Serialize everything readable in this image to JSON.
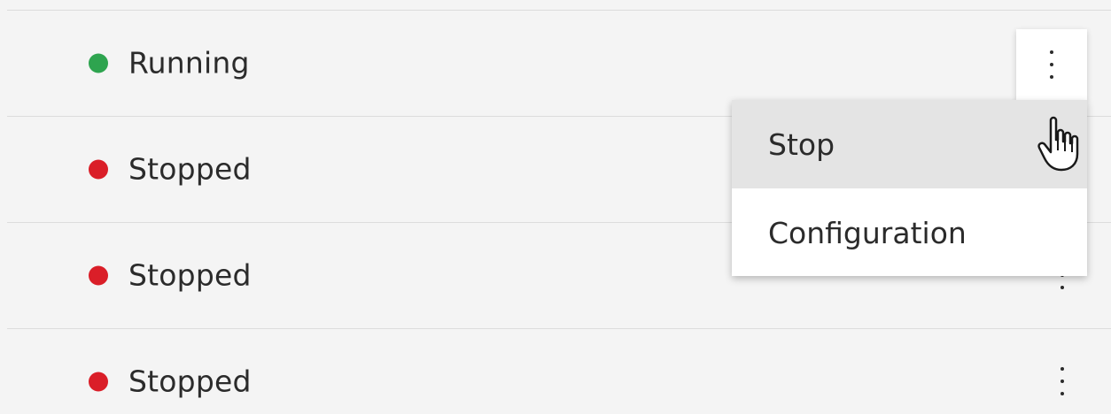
{
  "rows": [
    {
      "status_label": "Running",
      "status_color": "#2ea44f"
    },
    {
      "status_label": "Stopped",
      "status_color": "#da1e28"
    },
    {
      "status_label": "Stopped",
      "status_color": "#da1e28"
    },
    {
      "status_label": "Stopped",
      "status_color": "#da1e28"
    }
  ],
  "overflow_menu": {
    "open_for_row": "Running",
    "items": [
      {
        "label": "Stop",
        "hovered": true
      },
      {
        "label": "Configuration",
        "hovered": false
      }
    ]
  },
  "icons": {
    "row_actions": "overflow-menu-vertical-icon",
    "cursor": "hand-pointer-icon"
  },
  "colors": {
    "background": "#f4f4f4",
    "menu_background": "#ffffff",
    "menu_hover": "#e4e4e4",
    "text": "#2b2b2b"
  }
}
